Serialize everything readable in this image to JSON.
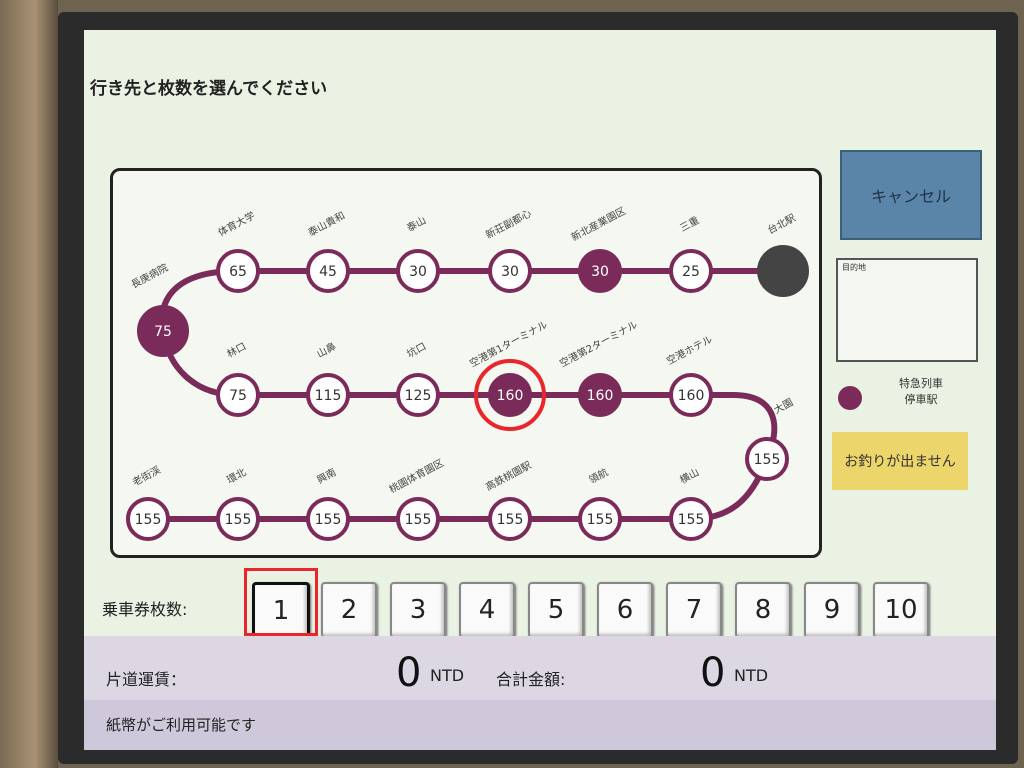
{
  "prompt": "行き先と枚数を選んでください",
  "cancel_label": "キャンセル",
  "destination": {
    "label": "目的地"
  },
  "legend": {
    "line1": "特急列車",
    "line2": "停車駅",
    "color": "#7b2b5a"
  },
  "no_change_label": "お釣りが出ません",
  "colors": {
    "line": "#7b2b5a",
    "express": "#7b2b5a",
    "terminal": "#444444",
    "highlight": "#e8262b"
  },
  "stations": [
    {
      "name": "台北駅",
      "fare": "",
      "type": "terminal"
    },
    {
      "name": "三重",
      "fare": "25",
      "type": "local"
    },
    {
      "name": "新北産業園区",
      "fare": "30",
      "type": "express"
    },
    {
      "name": "新荘副都心",
      "fare": "30",
      "type": "local"
    },
    {
      "name": "泰山",
      "fare": "30",
      "type": "local"
    },
    {
      "name": "泰山貴和",
      "fare": "45",
      "type": "local"
    },
    {
      "name": "体育大学",
      "fare": "65",
      "type": "local"
    },
    {
      "name": "長庚病院",
      "fare": "75",
      "type": "express"
    },
    {
      "name": "林口",
      "fare": "75",
      "type": "local"
    },
    {
      "name": "山鼻",
      "fare": "115",
      "type": "local"
    },
    {
      "name": "坑口",
      "fare": "125",
      "type": "local"
    },
    {
      "name": "空港第1ターミナル",
      "fare": "160",
      "type": "express",
      "selected": true
    },
    {
      "name": "空港第2ターミナル",
      "fare": "160",
      "type": "express"
    },
    {
      "name": "空港ホテル",
      "fare": "160",
      "type": "local"
    },
    {
      "name": "大園",
      "fare": "155",
      "type": "local"
    },
    {
      "name": "横山",
      "fare": "155",
      "type": "local"
    },
    {
      "name": "領航",
      "fare": "155",
      "type": "local"
    },
    {
      "name": "高鉄桃園駅",
      "fare": "155",
      "type": "local"
    },
    {
      "name": "桃園体育園区",
      "fare": "155",
      "type": "local"
    },
    {
      "name": "興南",
      "fare": "155",
      "type": "local"
    },
    {
      "name": "環北",
      "fare": "155",
      "type": "local"
    },
    {
      "name": "老街渓",
      "fare": "155",
      "type": "local"
    }
  ],
  "quantity": {
    "label": "乗車券枚数:",
    "options": [
      "1",
      "2",
      "3",
      "4",
      "5",
      "6",
      "7",
      "8",
      "9",
      "10"
    ],
    "selected": "1"
  },
  "fare": {
    "one_way_label": "片道運賃：",
    "one_way_amount": "0",
    "total_label": "合計金額:",
    "total_amount": "0",
    "unit": "NTD"
  },
  "status": "紙幣がご利用可能です"
}
